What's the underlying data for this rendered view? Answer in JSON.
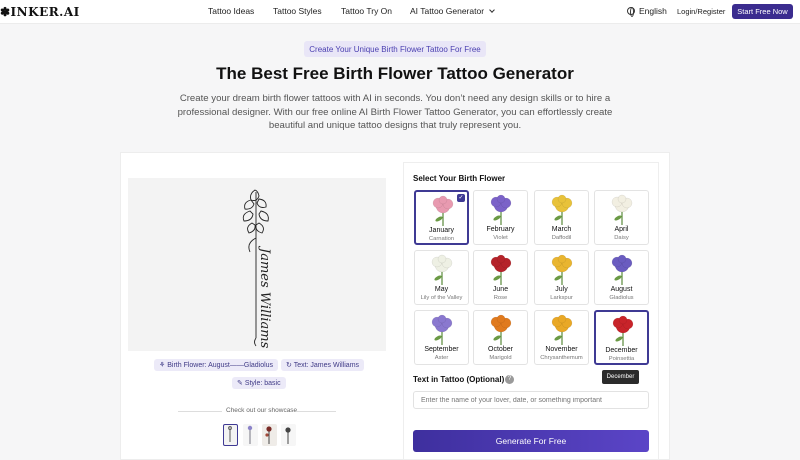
{
  "nav": {
    "logo": "✽INKER.AI",
    "links": [
      "Tattoo Ideas",
      "Tattoo Styles",
      "Tattoo Try On",
      "AI Tattoo Generator"
    ],
    "language": "English",
    "login": "Login/Register",
    "start": "Start Free Now"
  },
  "hero": {
    "pill": "Create Your Unique Birth Flower Tattoo For Free",
    "title": "The Best Free Birth Flower Tattoo Generator",
    "subtitle": "Create your dream birth flower tattoos with AI in seconds. You don’t need any design skills or to hire a professional designer. With our free online AI Birth Flower Tattoo Generator, you can effortlessly create beautiful and unique tattoo designs that truly represent you."
  },
  "preview": {
    "tattoo_text": "James Williams",
    "tag_flower": "Birth Flower: August——Gladiolus",
    "tag_text": "Text: James Williams",
    "tag_style": "Style: basic",
    "showcase": "Check out our showcase."
  },
  "form": {
    "select_title": "Select Your Birth Flower",
    "months": [
      {
        "month": "January",
        "flower": "Carnation",
        "color": "#e89ab0"
      },
      {
        "month": "February",
        "flower": "Violet",
        "color": "#7b62c8"
      },
      {
        "month": "March",
        "flower": "Daffodil",
        "color": "#e8c23a"
      },
      {
        "month": "April",
        "flower": "Daisy",
        "color": "#f2efe2"
      },
      {
        "month": "May",
        "flower": "Lily of the Valley",
        "color": "#eef0e4"
      },
      {
        "month": "June",
        "flower": "Rose",
        "color": "#b5232a"
      },
      {
        "month": "July",
        "flower": "Larkspur",
        "color": "#e9b530"
      },
      {
        "month": "August",
        "flower": "Gladiolus",
        "color": "#6a5cc0"
      },
      {
        "month": "September",
        "flower": "Aster",
        "color": "#8a78cf"
      },
      {
        "month": "October",
        "flower": "Marigold",
        "color": "#e07a1e"
      },
      {
        "month": "November",
        "flower": "Chrysanthemum",
        "color": "#e9a826"
      },
      {
        "month": "December",
        "flower": "Poinsettia",
        "color": "#c8242a"
      }
    ],
    "tooltip": "December",
    "text_label": "Text in Tattoo (Optional)",
    "info_icon": "?",
    "text_placeholder": "Enter the name of your lover, date, or something important",
    "generate": "Generate For Free"
  }
}
